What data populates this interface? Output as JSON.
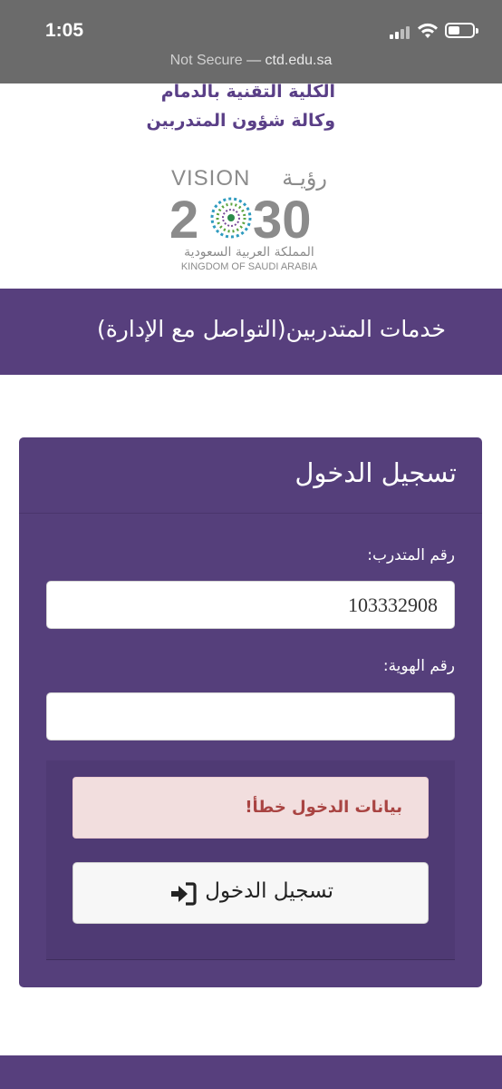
{
  "status_bar": {
    "time": "1:05"
  },
  "url_bar": {
    "security": "Not Secure",
    "separator": " — ",
    "domain": "ctd.edu.sa"
  },
  "header": {
    "college_line1": "الكلية التقنية بالدمام",
    "college_line2": "وكالة شؤون المتدربين",
    "logo_vision_word": "VISION",
    "logo_vision_arabic": "رؤيـة",
    "logo_year_left": "2",
    "logo_year_right": "30",
    "logo_kingdom_arabic": "المملكة العربية السعودية",
    "logo_kingdom_english": "KINGDOM OF SAUDI ARABIA"
  },
  "banner": {
    "title": "خدمات المتدربين(التواصل مع الإدارة)"
  },
  "login": {
    "title": "تسجيل الدخول",
    "trainee_label": "رقم المتدرب:",
    "trainee_value": "103332908",
    "id_label": "رقم الهوية:",
    "id_value": "",
    "error_message": "بيانات الدخول خطأ!",
    "submit_label": "تسجيل الدخول"
  },
  "colors": {
    "primary_purple": "#573f7d",
    "alert_bg": "#f2dede",
    "alert_text": "#a94442"
  },
  "icons": {
    "signal": "cellular-signal-icon",
    "wifi": "wifi-icon",
    "battery": "battery-icon",
    "submit": "sign-in-icon"
  }
}
